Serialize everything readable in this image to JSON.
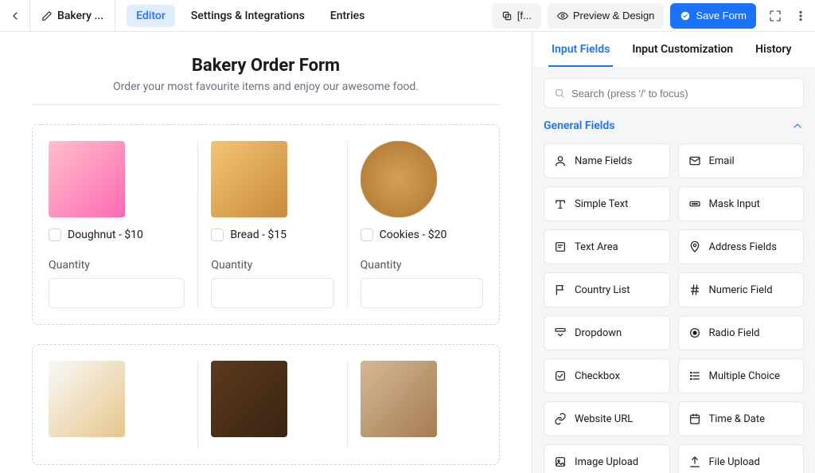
{
  "header": {
    "doc_title": "Bakery ...",
    "nav": {
      "editor": "Editor",
      "settings": "Settings & Integrations",
      "entries": "Entries"
    },
    "shortcode_btn": "[f...",
    "preview_btn": "Preview & Design",
    "save_btn": "Save Form"
  },
  "form": {
    "title": "Bakery Order Form",
    "subtitle": "Order your most favourite items and enjoy our awesome food.",
    "qty_label": "Quantity",
    "products_row1": [
      {
        "label": "Doughnut - $10",
        "img": "donut"
      },
      {
        "label": "Bread - $15",
        "img": "bread"
      },
      {
        "label": "Cookies - $20",
        "img": "cookie"
      }
    ],
    "products_row2": [
      {
        "img": "muffin"
      },
      {
        "img": "brownie"
      },
      {
        "img": "sandwich"
      }
    ]
  },
  "sidebar": {
    "tabs": {
      "input_fields": "Input Fields",
      "customization": "Input Customization",
      "history": "History"
    },
    "search_placeholder": "Search (press '/' to focus)",
    "section": "General Fields",
    "fields": [
      {
        "icon": "user",
        "label": "Name Fields"
      },
      {
        "icon": "mail",
        "label": "Email"
      },
      {
        "icon": "text",
        "label": "Simple Text"
      },
      {
        "icon": "mask",
        "label": "Mask Input"
      },
      {
        "icon": "textarea",
        "label": "Text Area"
      },
      {
        "icon": "pin",
        "label": "Address Fields"
      },
      {
        "icon": "flag",
        "label": "Country List"
      },
      {
        "icon": "hash",
        "label": "Numeric Field"
      },
      {
        "icon": "dropdown",
        "label": "Dropdown"
      },
      {
        "icon": "radio",
        "label": "Radio Field"
      },
      {
        "icon": "check",
        "label": "Checkbox"
      },
      {
        "icon": "list",
        "label": "Multiple Choice"
      },
      {
        "icon": "link",
        "label": "Website URL"
      },
      {
        "icon": "calendar",
        "label": "Time & Date"
      },
      {
        "icon": "image",
        "label": "Image Upload"
      },
      {
        "icon": "upload",
        "label": "File Upload"
      }
    ]
  }
}
